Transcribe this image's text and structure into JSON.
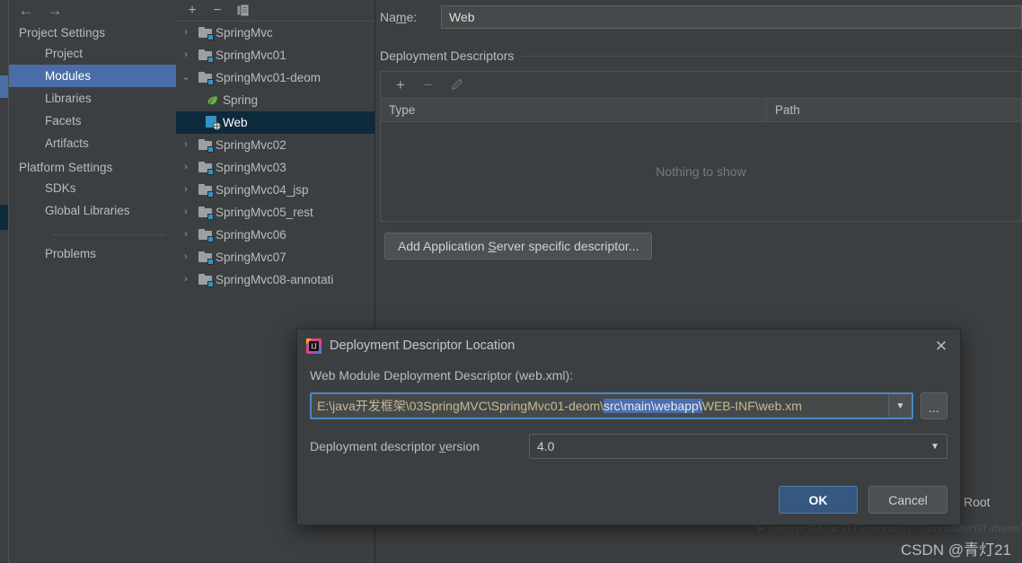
{
  "nav": {
    "back_icon": "arrow-left-icon",
    "forward_icon": "arrow-right-icon",
    "groups": [
      {
        "title": "Project Settings",
        "items": [
          {
            "label": "Project",
            "selected": false
          },
          {
            "label": "Modules",
            "selected": true
          },
          {
            "label": "Libraries",
            "selected": false
          },
          {
            "label": "Facets",
            "selected": false
          },
          {
            "label": "Artifacts",
            "selected": false
          }
        ]
      },
      {
        "title": "Platform Settings",
        "items": [
          {
            "label": "SDKs",
            "selected": false
          },
          {
            "label": "Global Libraries",
            "selected": false
          }
        ]
      }
    ],
    "footer_item": "Problems"
  },
  "tree": {
    "toolbar": [
      {
        "name": "add-module-button",
        "glyph": "+"
      },
      {
        "name": "remove-module-button",
        "glyph": "−"
      },
      {
        "name": "copy-module-button",
        "glyph": "‖"
      }
    ],
    "rows": [
      {
        "label": "SpringMvc",
        "twist": "›",
        "icon": "module-folder-icon",
        "depth": 0,
        "selected": false
      },
      {
        "label": "SpringMvc01",
        "twist": "›",
        "icon": "module-folder-icon",
        "depth": 0,
        "selected": false
      },
      {
        "label": "SpringMvc01-deom",
        "twist": "⌄",
        "icon": "module-folder-icon",
        "depth": 0,
        "selected": false
      },
      {
        "label": "Spring",
        "twist": "",
        "icon": "spring-leaf-icon",
        "depth": 1,
        "selected": false
      },
      {
        "label": "Web",
        "twist": "",
        "icon": "web-facet-icon",
        "depth": 1,
        "selected": true
      },
      {
        "label": "SpringMvc02",
        "twist": "›",
        "icon": "module-folder-icon",
        "depth": 0,
        "selected": false
      },
      {
        "label": "SpringMvc03",
        "twist": "›",
        "icon": "module-folder-icon",
        "depth": 0,
        "selected": false
      },
      {
        "label": "SpringMvc04_jsp",
        "twist": "›",
        "icon": "module-folder-icon",
        "depth": 0,
        "selected": false
      },
      {
        "label": "SpringMvc05_rest",
        "twist": "›",
        "icon": "module-folder-icon",
        "depth": 0,
        "selected": false
      },
      {
        "label": "SpringMvc06",
        "twist": "›",
        "icon": "module-folder-icon",
        "depth": 0,
        "selected": false
      },
      {
        "label": "SpringMvc07",
        "twist": "›",
        "icon": "module-folder-icon",
        "depth": 0,
        "selected": false
      },
      {
        "label": "SpringMvc08-annotati",
        "twist": "›",
        "icon": "module-folder-icon",
        "depth": 0,
        "selected": false
      }
    ]
  },
  "detail": {
    "name_label": "Name:",
    "name_label_pre": "Na",
    "name_label_accel": "m",
    "name_label_post": "e:",
    "name_value": "Web",
    "section_title": "Deployment Descriptors",
    "toolbar": [
      {
        "name": "add-descriptor-button",
        "glyph": "+",
        "dim": false
      },
      {
        "name": "remove-descriptor-button",
        "glyph": "−",
        "dim": true
      },
      {
        "name": "edit-descriptor-button",
        "glyph": "✎",
        "dim": true
      }
    ],
    "columns": [
      "Type",
      "Path"
    ],
    "empty_text": "Nothing to show",
    "add_button_pre": "Add Application ",
    "add_button_accel": "S",
    "add_button_post": "erver specific descriptor...",
    "root_label": "Root"
  },
  "dialog": {
    "icon": "intellij-idea-icon",
    "title": "Deployment Descriptor Location",
    "close_icon": "close-icon",
    "path_label": "Web Module Deployment Descriptor (web.xml):",
    "path_value_prefix": "E:\\java开发框架\\03SpringMVC\\SpringMvc01-deom\\",
    "path_value_selected": "src\\main\\webapp\\",
    "path_value_suffix": "WEB-INF\\web.xm",
    "path_dropdown_icon": "chevron-down-icon",
    "path_browse_label": "...",
    "version_label_pre": "Deployment descriptor ",
    "version_label_accel": "v",
    "version_label_post": "ersion",
    "version_value": "4.0",
    "version_caret_icon": "chevron-down-icon",
    "ok_label": "OK",
    "cancel_label": "Cancel"
  },
  "watermark": {
    "text": "CSDN @青灯21"
  },
  "colors": {
    "window_bg": "#3c3f41",
    "nav_selection": "#4a6da7",
    "tree_selection": "#0e2a3d",
    "accent_blue": "#3592c4",
    "primary_button": "#365880",
    "field_focus_border": "#4a88c7",
    "path_text": "#c8b98f",
    "text_highlight": "#4b6eaf"
  }
}
